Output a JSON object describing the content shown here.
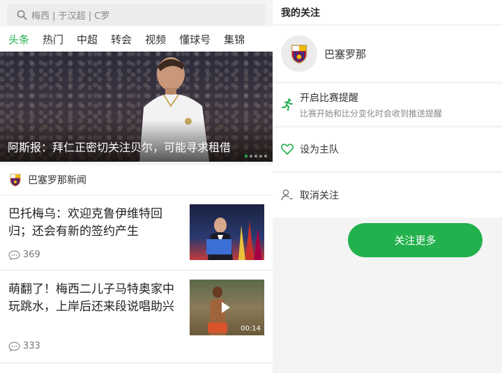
{
  "search": {
    "placeholder": "梅西 | 于汉超 | C罗"
  },
  "tabs": [
    "头条",
    "热门",
    "中超",
    "转会",
    "视频",
    "懂球号",
    "集锦"
  ],
  "active_tab": 0,
  "hero": {
    "caption": "阿斯报：拜仁正密切关注贝尔，可能寻求租借"
  },
  "club_section": {
    "label": "巴塞罗那新闻"
  },
  "news": [
    {
      "title": "巴托梅乌：欢迎克鲁伊维特回归；还会有新的签约产生",
      "comments": "369"
    },
    {
      "title": "萌翻了！梅西二儿子马特奥家中玩跳水，上岸后还来段说唱助兴",
      "comments": "333",
      "duration": "00:14"
    }
  ],
  "right": {
    "header": "我的关注",
    "team_name": "巴塞罗那",
    "options": [
      {
        "title": "开启比赛提醒",
        "desc": "比赛开始和比分变化时会收到推送提醒"
      },
      {
        "title": "设为主队"
      },
      {
        "title": "取消关注"
      }
    ],
    "follow_more": "关注更多"
  },
  "colors": {
    "accent": "#22b14c"
  }
}
